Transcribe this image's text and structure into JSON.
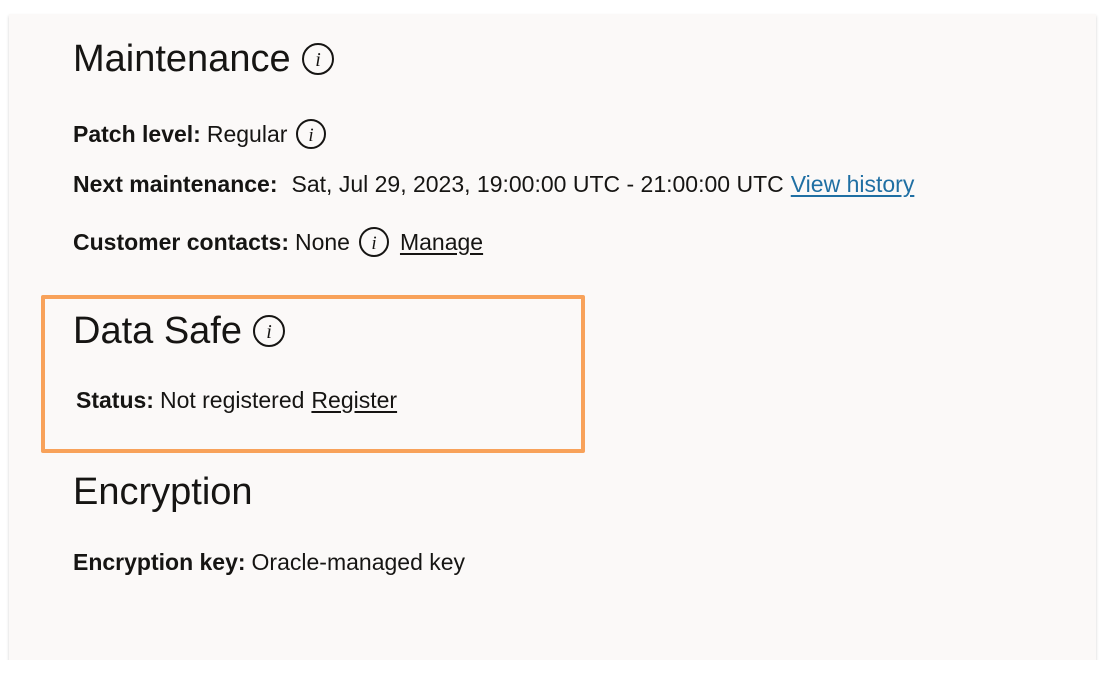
{
  "maintenance": {
    "title": "Maintenance",
    "patch_level_label": "Patch level:",
    "patch_level_value": "Regular",
    "next_maintenance_label": "Next maintenance:",
    "next_maintenance_value": "Sat, Jul 29, 2023, 19:00:00 UTC - 21:00:00 UTC",
    "view_history_link": "View history",
    "customer_contacts_label": "Customer contacts:",
    "customer_contacts_value": "None",
    "manage_link": "Manage"
  },
  "data_safe": {
    "title": "Data Safe",
    "status_label": "Status:",
    "status_value": "Not registered",
    "register_link": "Register",
    "highlight_color": "#f8a25a"
  },
  "encryption": {
    "title": "Encryption",
    "key_label": "Encryption key:",
    "key_value": "Oracle-managed key"
  },
  "colors": {
    "panel_bg": "#fbf9f8",
    "text": "#161513",
    "link_blue": "#1f6fa3"
  },
  "icons": {
    "info": "info-icon"
  }
}
